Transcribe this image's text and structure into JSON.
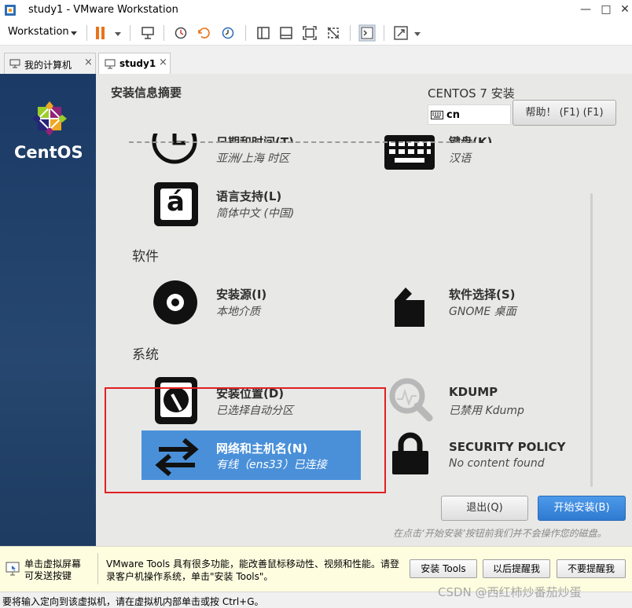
{
  "window": {
    "title": "study1 - VMware Workstation"
  },
  "toolbar": {
    "menu_label": "Workstation"
  },
  "tabs": [
    {
      "label": "我的计算机",
      "active": false
    },
    {
      "label": "study1",
      "active": true
    }
  ],
  "installer": {
    "brand": "CentOS",
    "summary_title": "安装信息摘要",
    "install_title": "CENTOS 7 安装",
    "keyboard_value": "cn",
    "help_button": "帮助！ (F1) (F1)",
    "spokes": {
      "datetime": {
        "title": "日期和时间(T)",
        "status": "亚洲/上海 时区"
      },
      "keyboard": {
        "title": "键盘(K)",
        "status": "汉语"
      },
      "language": {
        "title": "语言支持(L)",
        "status": "简体中文 (中国)"
      },
      "source": {
        "title": "安装源(I)",
        "status": "本地介质"
      },
      "software": {
        "title": "软件选择(S)",
        "status": "GNOME 桌面"
      },
      "destination": {
        "title": "安装位置(D)",
        "status": "已选择自动分区"
      },
      "kdump": {
        "title": "KDUMP",
        "status": "已禁用 Kdump"
      },
      "network": {
        "title": "网络和主机名(N)",
        "status": "有线（ens33）已连接"
      },
      "security": {
        "title": "SECURITY POLICY",
        "status": "No content found"
      }
    },
    "sections": {
      "software": "软件",
      "system": "系统"
    },
    "quit_button": "退出(Q)",
    "begin_button": "开始安装(B)",
    "notice": "在点击‘开始安装’按钮前我们并不会操作您的磁盘。"
  },
  "hint_bar": {
    "left_line1": "单击虚拟屏幕",
    "left_line2": "可发送按键",
    "message": "VMware Tools 具有很多功能，能改善鼠标移动性、视频和性能。请登录客户机操作系统，单击\"安装 Tools\"。",
    "install_tools": "安装 Tools",
    "remind_later": "以后提醒我",
    "dont_remind": "不要提醒我"
  },
  "status_bar": {
    "text": "要将输入定向到该虚拟机，请在虚拟机内部单击或按 Ctrl+G。"
  },
  "watermark": "CSDN @西红柿炒番茄炒蛋",
  "colors": {
    "accent": "#4a90d9",
    "sidebar": "#1e3b61",
    "highlight_box": "#e02020"
  }
}
